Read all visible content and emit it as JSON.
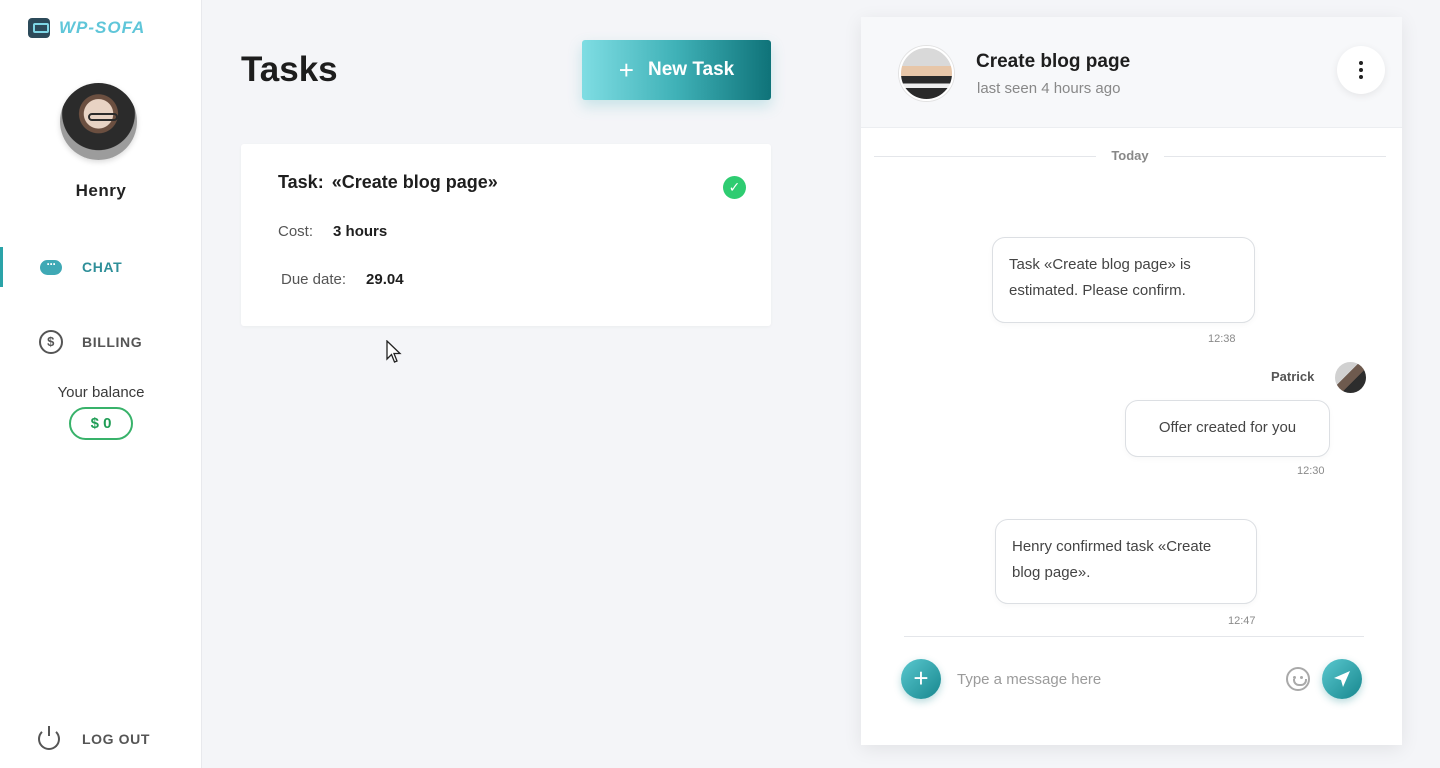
{
  "brand": {
    "logo_text": "WP-SOFA"
  },
  "user": {
    "name": "Henry"
  },
  "nav": {
    "chat_label": "CHAT",
    "billing_label": "BILLING",
    "logout_label": "LOG OUT"
  },
  "balance": {
    "label": "Your balance",
    "value": "$ 0"
  },
  "main": {
    "title": "Tasks",
    "new_task_label": "New Task"
  },
  "task": {
    "title_prefix": "Task:",
    "title_name": "«Create blog page»",
    "cost_label": "Cost:",
    "cost_value": "3 hours",
    "due_label": "Due date:",
    "due_value": "29.04",
    "status": "completed"
  },
  "chat": {
    "title": "Create blog page",
    "subtitle": "last seen 4 hours ago",
    "day_label": "Today",
    "messages": [
      {
        "text": "Task «Create blog page» is estimated. Please confirm.",
        "time": "12:38"
      },
      {
        "sender": "Patrick",
        "text": "Offer created for you",
        "time": "12:30"
      },
      {
        "text": "Henry confirmed task «Create blog page».",
        "time": "12:47"
      }
    ],
    "input_placeholder": "Type a message here"
  },
  "colors": {
    "accent": "#2aa3a8",
    "success": "#2ecc71",
    "button_gradient_start": "#7fdde3",
    "button_gradient_end": "#0f7379"
  }
}
